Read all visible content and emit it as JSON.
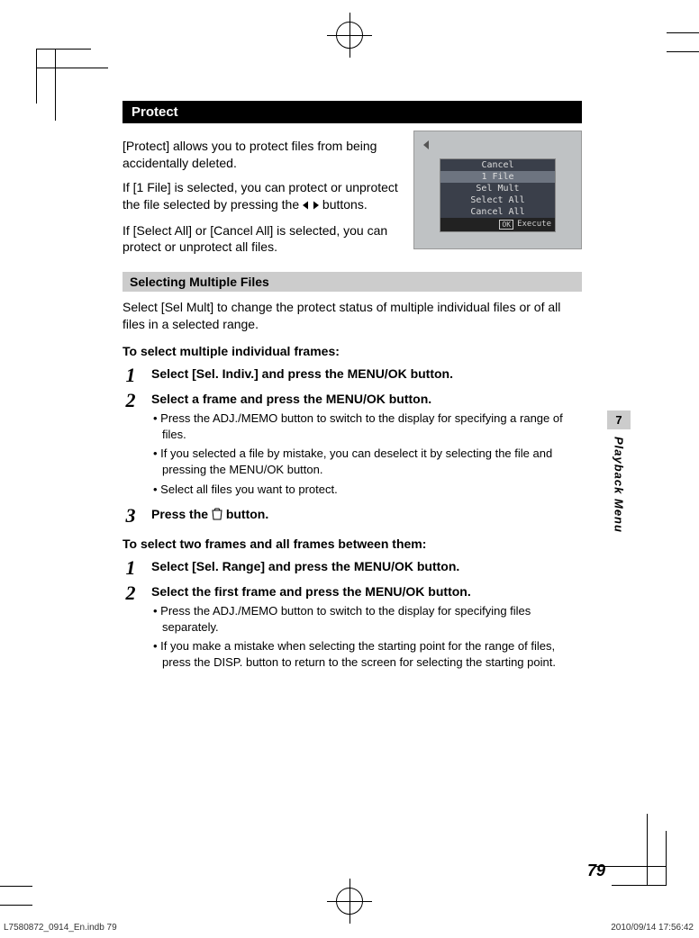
{
  "header": {
    "title": "Protect"
  },
  "intro": {
    "p1": "[Protect] allows you to protect files from being accidentally deleted.",
    "p2a": "If [1 File] is selected, you can protect or unprotect the file selected by pressing the ",
    "p2b": " buttons.",
    "p3": "If [Select All] or [Cancel All] is selected, you can protect or unprotect all files."
  },
  "menu": {
    "items": [
      "Cancel",
      "1 File",
      "Sel Mult",
      "Select All",
      "Cancel All"
    ],
    "ok": "OK",
    "exec": "Execute"
  },
  "sub1": {
    "title": "Selecting Multiple Files"
  },
  "p_sel": "Select [Sel Mult] to change the protect status of multiple individual files or of all files in a selected range.",
  "h_indiv": "To select multiple individual frames:",
  "steps1": [
    {
      "t": "Select [Sel. Indiv.] and press the MENU/OK button."
    },
    {
      "t": "Select a frame and press the MENU/OK button.",
      "b": [
        "Press the ADJ./MEMO button to switch to the display for specifying a range of files.",
        "If you selected a file by mistake, you can deselect it by selecting the file and pressing the MENU/OK button.",
        "Select all files you want to protect."
      ]
    },
    {
      "t_a": "Press the ",
      "t_b": " button."
    }
  ],
  "h_range": "To select two frames and all frames between them:",
  "steps2": [
    {
      "t": "Select [Sel. Range] and press the MENU/OK button."
    },
    {
      "t": "Select the first frame and press the MENU/OK button.",
      "b": [
        "Press the ADJ./MEMO button to switch to the display for specifying files separately.",
        "If you make a mistake when selecting the starting point for the range of files, press the DISP. button to return to the screen for selecting the starting point."
      ]
    }
  ],
  "tab": {
    "num": "7",
    "label": "Playback Menu"
  },
  "page_num": "79",
  "footer": {
    "left": "L7580872_0914_En.indb   79",
    "right": "2010/09/14   17:56:42"
  }
}
